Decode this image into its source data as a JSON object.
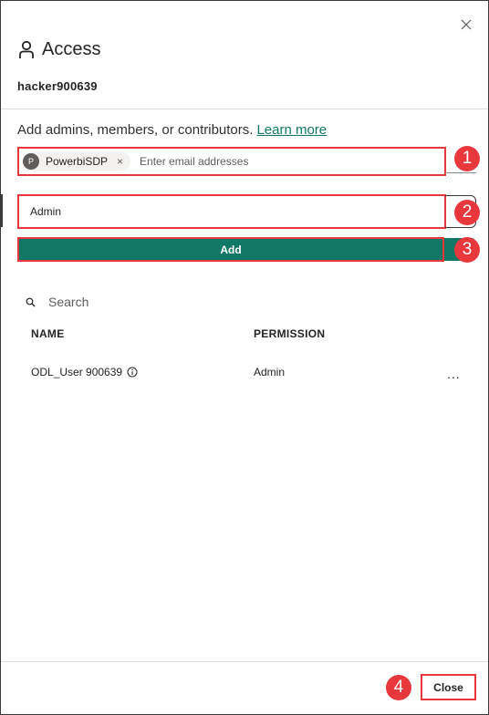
{
  "dialog": {
    "title": "Access",
    "workspace_name": "hacker900639",
    "description": "Add admins, members, or contributors.",
    "learn_more": "Learn more"
  },
  "invite": {
    "chip_initial": "P",
    "chip_label": "PowerbiSDP",
    "chip_remove": "×",
    "email_placeholder": "Enter email addresses",
    "role_value": "Admin",
    "add_label": "Add"
  },
  "list": {
    "search_placeholder": "Search",
    "columns": {
      "name": "NAME",
      "permission": "PERMISSION"
    },
    "rows": [
      {
        "name": "ODL_User 900639",
        "permission": "Admin",
        "more": "..."
      }
    ]
  },
  "footer": {
    "close_label": "Close"
  },
  "callouts": [
    "1",
    "2",
    "3",
    "4"
  ],
  "colors": {
    "accent": "#117865",
    "highlight": "#e8383d"
  }
}
